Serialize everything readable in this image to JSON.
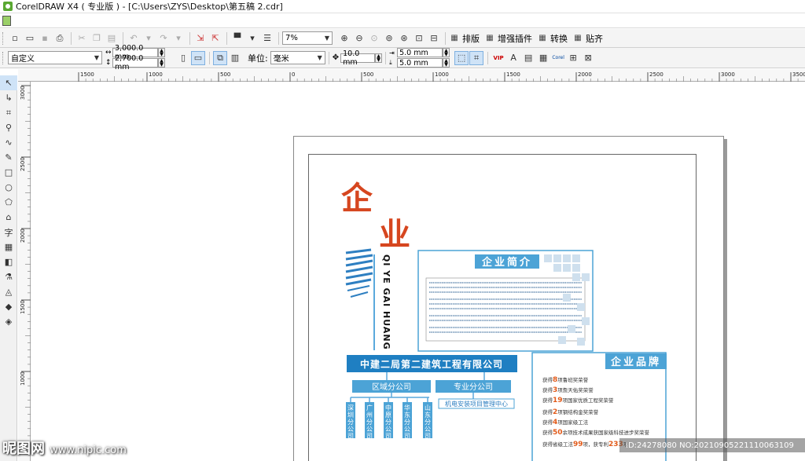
{
  "window": {
    "title": "CorelDRAW X4 ( 专业版 ) - [C:\\Users\\ZYS\\Desktop\\第五稿 2.cdr]"
  },
  "toolbar_standard": {
    "zoom": "7%",
    "commands": [
      {
        "label": "排版",
        "icon": "layout-icon"
      },
      {
        "label": "增强插件",
        "icon": "plugin-icon"
      },
      {
        "label": "转换",
        "icon": "convert-icon"
      },
      {
        "label": "贴齐",
        "icon": "snap-icon"
      }
    ]
  },
  "property_bar": {
    "paper_preset": "自定义",
    "width": "3,000.0 mm",
    "height": "2,700.0 mm",
    "units_label": "单位:",
    "units_value": "毫米",
    "nudge": "10.0 mm",
    "dup_x": "5.0 mm",
    "dup_y": "5.0 mm",
    "plugin_labels": [
      "VIP",
      "Corel"
    ]
  },
  "ruler_h_ticks": [
    "1500",
    "1000",
    "500",
    "0",
    "500",
    "1000",
    "1500",
    "2000",
    "2500",
    "3000",
    "3500"
  ],
  "ruler_v_ticks": [
    "3000",
    "2500",
    "2000",
    "1500",
    "1000"
  ],
  "design": {
    "logo_text": "企业",
    "vertical_text": "QI YE GAI HUANG",
    "intro_title": "企业简介",
    "brand_title": "企业品牌",
    "company": "中建二局第二建筑工程有限公司",
    "branch_a": "区域分公司",
    "branch_b": "专业分公司",
    "sub_branches": [
      "深圳分公司",
      "广州分公司",
      "中原分公司",
      "华东分公司",
      "山东分公司"
    ],
    "center": "机电安装项目管理中心",
    "awards": [
      {
        "pre": "获得",
        "num": "8",
        "post": "项鲁班奖荣誉"
      },
      {
        "pre": "获得",
        "num": "3",
        "post": "项詹天佑奖荣誉"
      },
      {
        "pre": "获得",
        "num": "19",
        "post": "项国家优质工程奖荣誉"
      },
      {
        "pre": "获得",
        "num": "2",
        "post": "项钢结构金奖荣誉"
      },
      {
        "pre": "获得",
        "num": "4",
        "post": "项国家级工法"
      },
      {
        "pre": "获得",
        "num": "50",
        "post": "余项技术成果获国家级科技进步奖荣誉"
      },
      {
        "pre": "获得省级工法",
        "num": "99",
        "post": "项，获专利",
        "num2": "233",
        "post2": "项"
      }
    ]
  },
  "watermark": {
    "site": "昵图网",
    "url": "www.nipic.com",
    "id": "ID:24278080 NO:20210905221110063109"
  }
}
